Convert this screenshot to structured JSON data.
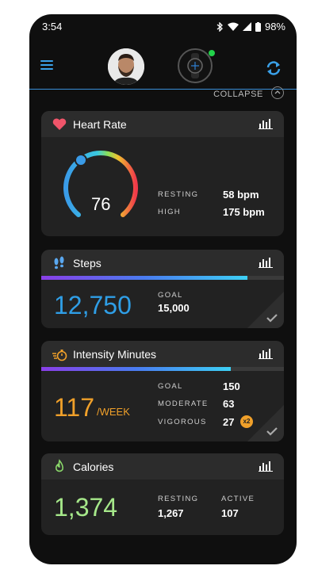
{
  "status_bar": {
    "time": "3:54",
    "battery": "98%"
  },
  "header": {
    "collapse_label": "COLLAPSE"
  },
  "heart_rate": {
    "title": "Heart Rate",
    "current": "76",
    "resting_label": "RESTING",
    "resting_value": "58 bpm",
    "high_label": "HIGH",
    "high_value": "175 bpm"
  },
  "steps": {
    "title": "Steps",
    "count": "12,750",
    "goal_label": "GOAL",
    "goal_value": "15,000",
    "progress_fraction": 0.85
  },
  "intensity": {
    "title": "Intensity Minutes",
    "value": "117",
    "unit": "/WEEK",
    "goal_label": "GOAL",
    "goal_value": "150",
    "moderate_label": "MODERATE",
    "moderate_value": "63",
    "vigorous_label": "VIGOROUS",
    "vigorous_value": "27",
    "vigorous_multiplier": "x2",
    "progress_fraction": 0.78
  },
  "calories": {
    "title": "Calories",
    "value": "1,374",
    "resting_label": "RESTING",
    "resting_value": "1,267",
    "active_label": "ACTIVE",
    "active_value": "107"
  },
  "colors": {
    "accent": "#3aa0e8",
    "steps": "#2f9ee6",
    "intensity": "#f0a02a",
    "calories": "#a6e88a"
  },
  "icons": [
    "wifi-icon",
    "signal-icon",
    "battery-icon",
    "bluetooth-icon",
    "menu-icon",
    "watch-icon",
    "sync-icon",
    "heart-icon",
    "footprints-icon",
    "stopwatch-icon",
    "flame-icon",
    "bar-chart-icon",
    "checkmark-icon"
  ]
}
